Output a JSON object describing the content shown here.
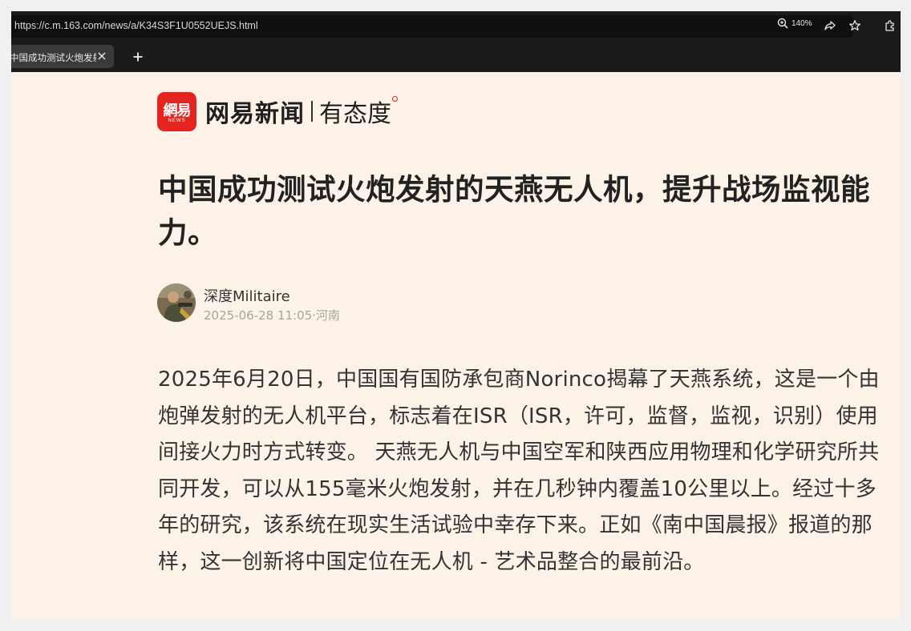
{
  "browser": {
    "url": "https://c.m.163.com/news/a/K34S3F1U0552UEJS.html",
    "zoom": "140%",
    "tab_title": "中国成功测试火炮发射的天燕无人机",
    "tab_close": "×",
    "new_tab": "+"
  },
  "brand": {
    "logo_text": "網易",
    "logo_sub": "NEWS",
    "name": "网易新闻",
    "slogan": "有态度",
    "color": "#e4241e"
  },
  "article": {
    "title": "中国成功测试火炮发射的天燕无人机，提升战场监视能力。",
    "author": "深度Militaire",
    "meta": "2025-06-28 11:05·河南",
    "body": "2025年6月20日，中国国有国防承包商Norinco揭幕了天燕系统，这是一个由炮弹发射的无人机平台，标志着在ISR（ISR，许可，监督，监视，识别）使用间接火力时方式转变。 天燕无人机与中国空军和陕西应用物理和化学研究所共同开发，可以从155毫米火炮发射，并在几秒钟内覆盖10公里以上。经过十多年的研究，该系统在现实生活试验中幸存下来。正如《南中国晨报》报道的那样，这一创新将中国定位在无人机 - 艺术品整合的最前沿。"
  },
  "icons": [
    "zoom-in-icon",
    "share-icon",
    "star-icon",
    "extensions-icon",
    "close-icon",
    "plus-icon"
  ]
}
